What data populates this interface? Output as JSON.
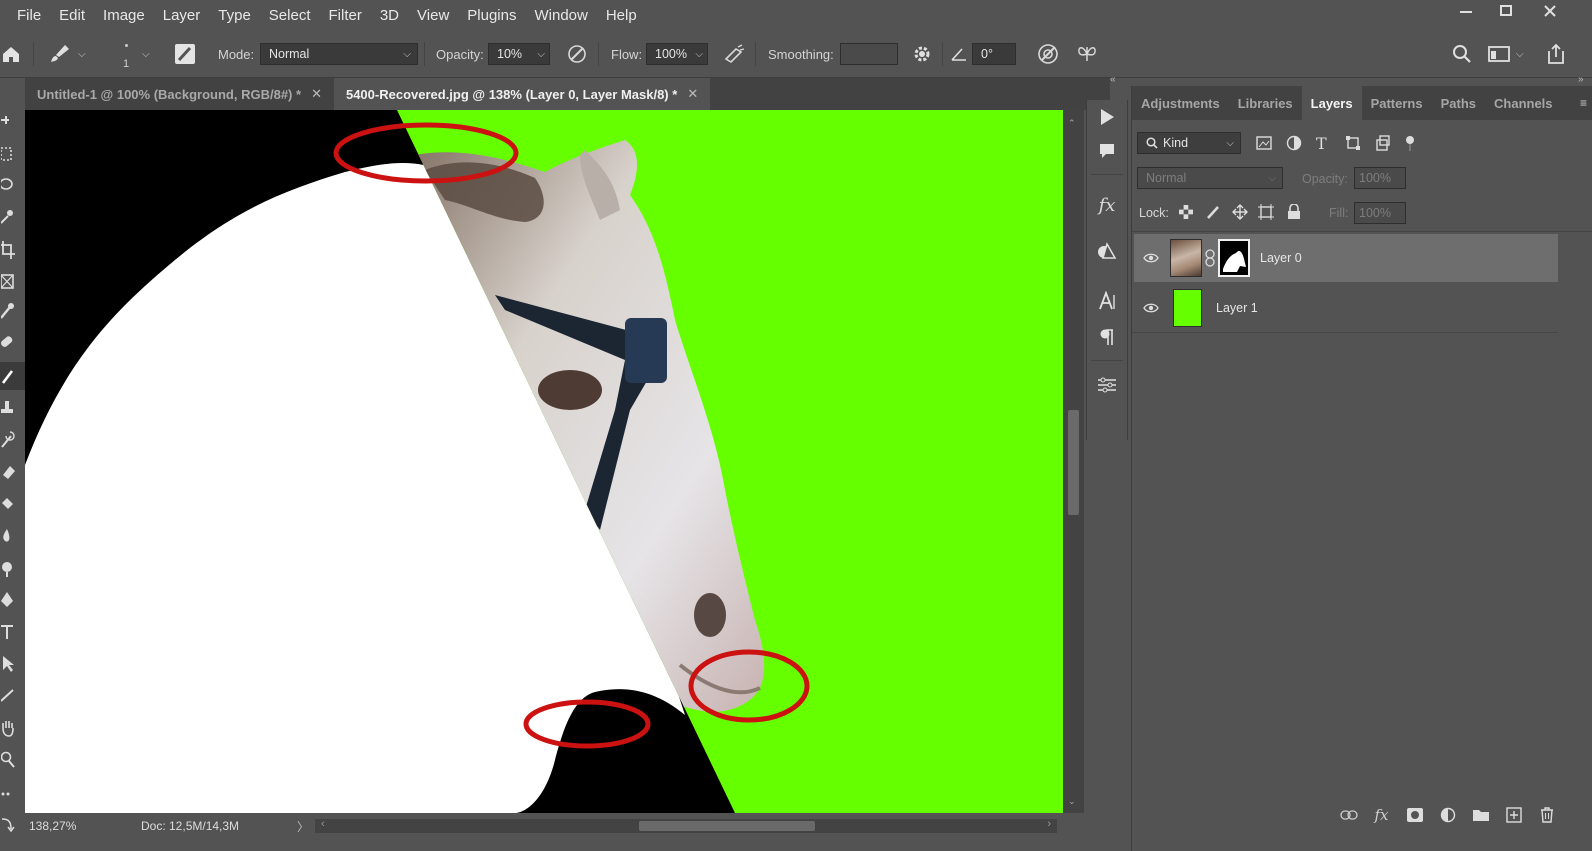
{
  "menubar": {
    "items": [
      "File",
      "Edit",
      "Image",
      "Layer",
      "Type",
      "Select",
      "Filter",
      "3D",
      "View",
      "Plugins",
      "Window",
      "Help"
    ],
    "window_controls": [
      "minimize-icon",
      "restore-icon",
      "close-icon"
    ]
  },
  "options_bar": {
    "brush_size": "1",
    "mode_label": "Mode:",
    "mode_value": "Normal",
    "opacity_label": "Opacity:",
    "opacity_value": "10%",
    "flow_label": "Flow:",
    "flow_value": "100%",
    "smoothing_label": "Smoothing:",
    "smoothing_value": "",
    "angle_value": "0°"
  },
  "tabs": [
    {
      "label": "Untitled-1 @ 100% (Background, RGB/8#) *",
      "active": false
    },
    {
      "label": "5400-Recovered.jpg @ 138% (Layer 0, Layer Mask/8) *",
      "active": true
    }
  ],
  "status": {
    "zoom": "138,27%",
    "doc": "Doc: 12,5M/14,3M"
  },
  "panel": {
    "tabs": [
      "Adjustments",
      "Libraries",
      "Layers",
      "Patterns",
      "Paths",
      "Channels"
    ],
    "active_tab": "Layers",
    "filter_kind": "Kind",
    "blend_mode": "Normal",
    "opacity_label": "Opacity:",
    "opacity_value": "100%",
    "lock_label": "Lock:",
    "fill_label": "Fill:",
    "fill_value": "100%",
    "layers": [
      {
        "name": "Layer 0",
        "selected": true,
        "visible": true
      },
      {
        "name": "Layer 1",
        "selected": false,
        "visible": true
      }
    ]
  },
  "colors": {
    "canvas_green": "#66ff00",
    "highlight_red": "#cc1111",
    "ui_background": "#535353",
    "selected_layer": "#6e6e6e"
  }
}
